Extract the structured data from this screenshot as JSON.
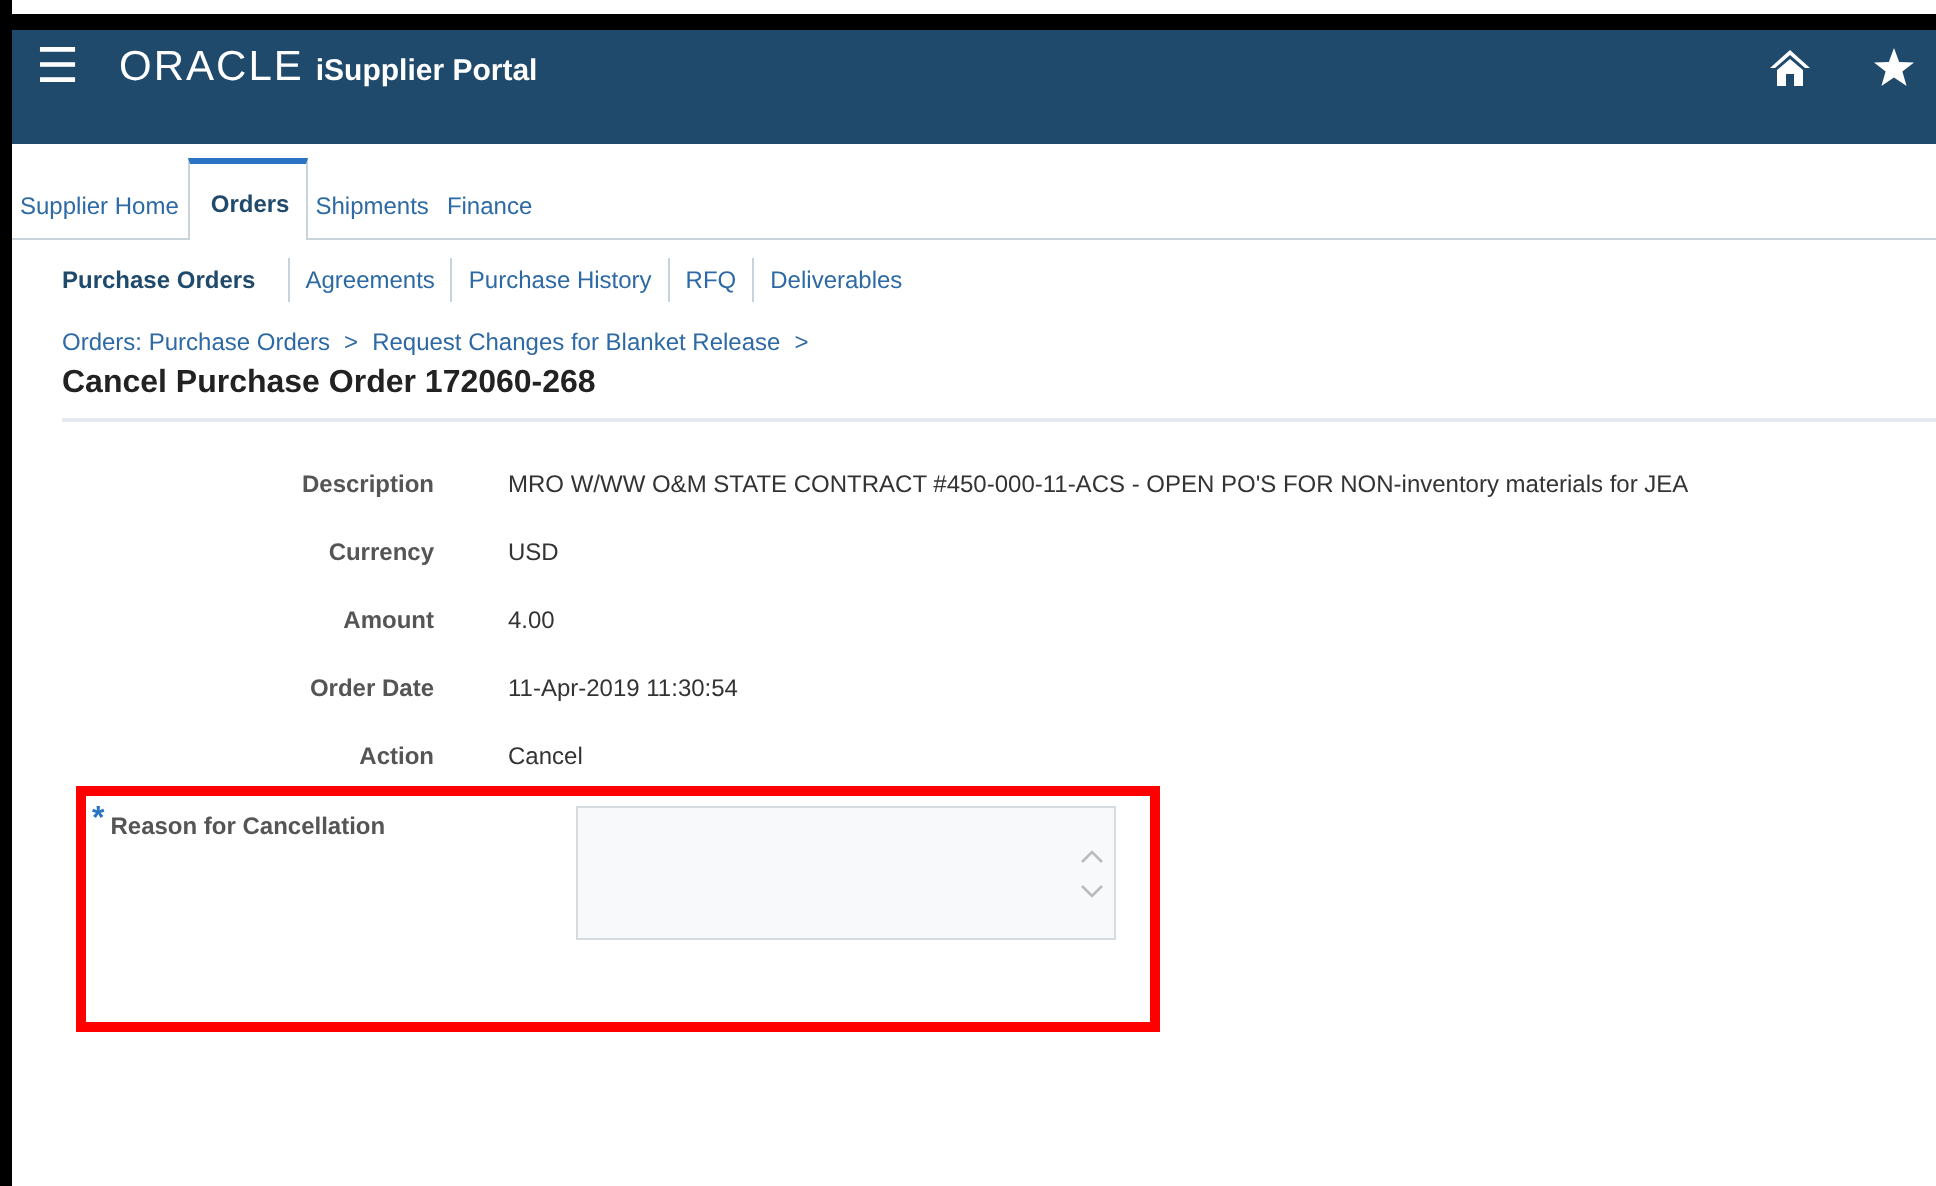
{
  "header": {
    "menu_glyph": "☰",
    "brand": "ORACLE",
    "product": "iSupplier Portal"
  },
  "tabs": [
    {
      "label": "Supplier Home",
      "selected": false
    },
    {
      "label": "Orders",
      "selected": true
    },
    {
      "label": "Shipments",
      "selected": false
    },
    {
      "label": "Finance",
      "selected": false
    }
  ],
  "subtabs": [
    {
      "label": "Purchase Orders",
      "selected": true
    },
    {
      "label": "Agreements",
      "selected": false
    },
    {
      "label": "Purchase History",
      "selected": false
    },
    {
      "label": "RFQ",
      "selected": false
    },
    {
      "label": "Deliverables",
      "selected": false
    }
  ],
  "breadcrumbs": [
    {
      "label": "Orders: Purchase Orders",
      "separator": ">"
    },
    {
      "label": "Request Changes for Blanket Release",
      "separator": ">"
    }
  ],
  "page_title": "Cancel Purchase Order 172060-268",
  "fields": [
    {
      "label": "Description",
      "value": "MRO W/WW O&M STATE CONTRACT #450-000-11-ACS - OPEN PO'S FOR NON-inventory materials for JEA"
    },
    {
      "label": "Currency",
      "value": "USD"
    },
    {
      "label": "Amount",
      "value": "4.00"
    },
    {
      "label": "Order Date",
      "value": "11-Apr-2019 11:30:54"
    },
    {
      "label": "Action",
      "value": "Cancel"
    }
  ],
  "reason": {
    "label": "Reason for Cancellation",
    "required": true,
    "required_mark": "*",
    "highlighted": true
  }
}
